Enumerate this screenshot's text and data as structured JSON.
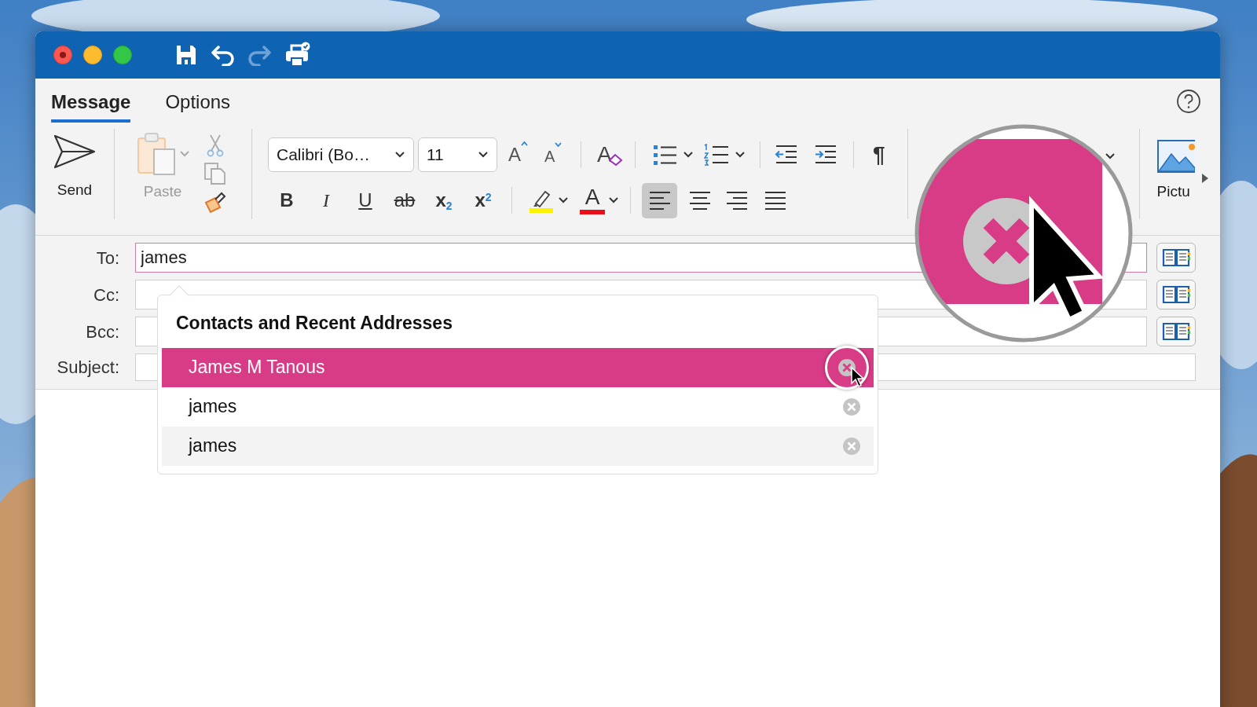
{
  "tabs": [
    {
      "label": "Message",
      "selected": true
    },
    {
      "label": "Options",
      "selected": false
    }
  ],
  "ribbon": {
    "send_label": "Send",
    "paste_label": "Paste",
    "font_name": "Calibri (Bo…",
    "font_size": "11",
    "grow_font": "A",
    "shrink_font": "A",
    "clear_format": "A",
    "pilcrow": "¶",
    "font_color_label": "A",
    "pictures_label": "Pictu",
    "format_buttons": [
      {
        "kind": "bold",
        "label": "B"
      },
      {
        "kind": "italic",
        "label": "I"
      },
      {
        "kind": "underline",
        "label": "U"
      },
      {
        "kind": "strike",
        "label": "ab"
      },
      {
        "kind": "subscript",
        "label": "x$_{2}$"
      },
      {
        "kind": "superscript",
        "label": "x$^{2}$"
      }
    ],
    "align_buttons": [
      {
        "kind": "left",
        "selected": true
      },
      {
        "kind": "center",
        "selected": false
      },
      {
        "kind": "right",
        "selected": false
      },
      {
        "kind": "justify",
        "selected": false
      }
    ]
  },
  "fields": [
    {
      "label": "To:",
      "value": "james",
      "focused": true,
      "address_book": true
    },
    {
      "label": "Cc:",
      "focused": false,
      "address_book": true
    },
    {
      "label": "Bcc:",
      "focused": false,
      "address_book": true
    },
    {
      "label": "Subject:",
      "focused": false,
      "address_book": false
    }
  ],
  "suggestions": {
    "title": "Contacts and Recent Addresses",
    "items": [
      {
        "name": "James M Tanous",
        "selected": true
      },
      {
        "name": "james",
        "selected": false
      },
      {
        "name": "james",
        "selected": false
      }
    ]
  }
}
